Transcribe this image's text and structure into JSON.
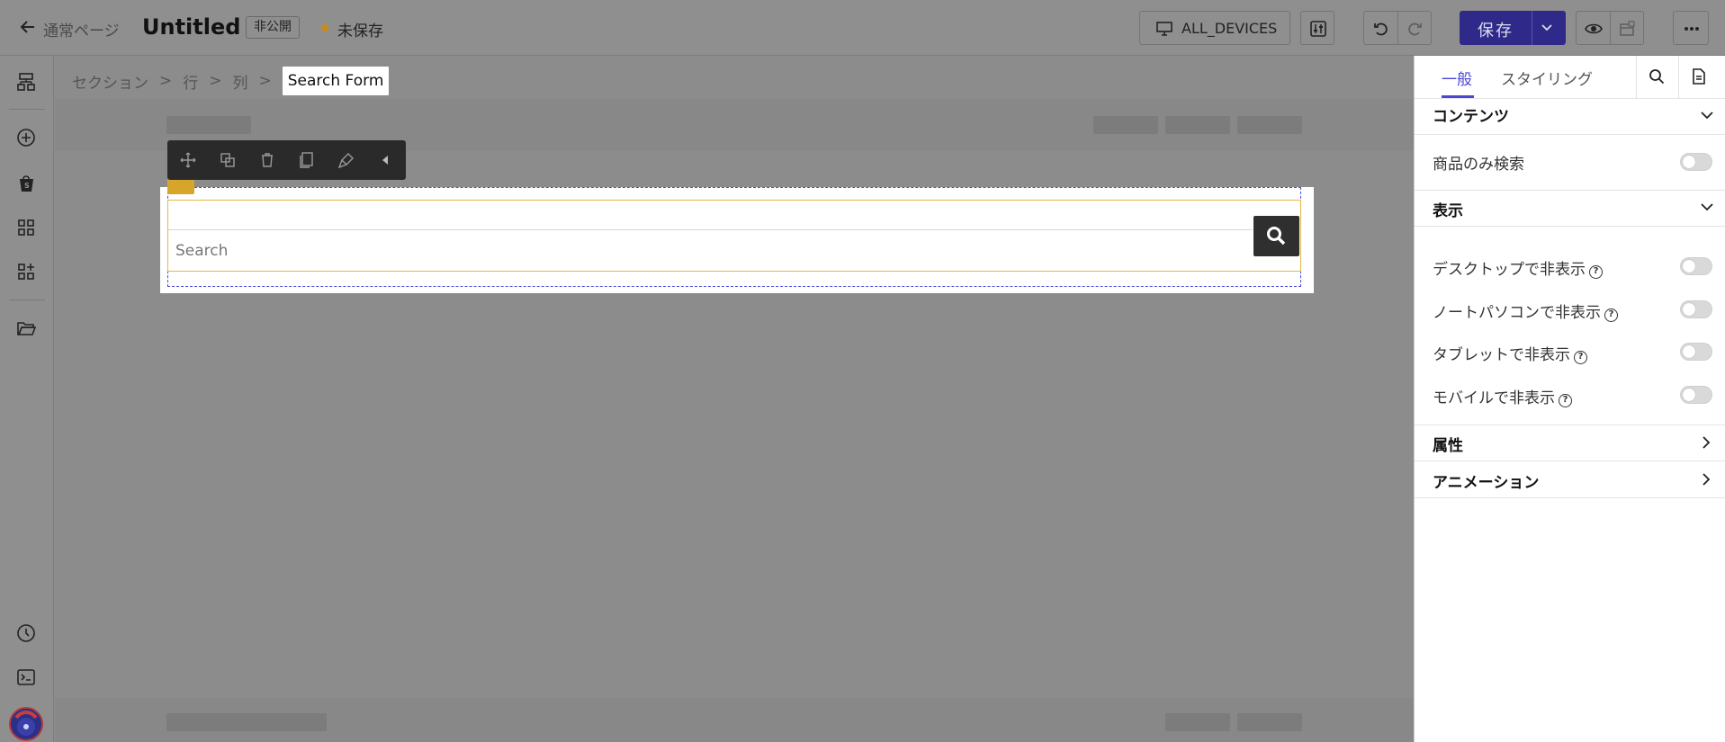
{
  "topbar": {
    "back_label": "通常ページ",
    "page_title": "Untitled",
    "privacy_badge": "非公開",
    "save_status": "未保存",
    "device_label": "ALL_DEVICES",
    "save_label": "保存"
  },
  "breadcrumb": {
    "items": [
      "セクション",
      "行",
      "列"
    ],
    "active": "Search Form"
  },
  "search_form": {
    "placeholder": "Search"
  },
  "panel": {
    "tabs": [
      "一般",
      "スタイリング"
    ],
    "active_tab": "一般",
    "sections": {
      "content": {
        "title": "コンテンツ",
        "products_only_label": "商品のみ検索"
      },
      "display": {
        "title": "表示",
        "hide_desktop": "デスクトップで非表示",
        "hide_laptop": "ノートパソコンで非表示",
        "hide_tablet": "タブレットで非表示",
        "hide_mobile": "モバイルで非表示"
      },
      "attributes": {
        "title": "属性"
      },
      "animation": {
        "title": "アニメーション"
      }
    }
  },
  "colors": {
    "accent": "#4a46d6",
    "save_button": "#2f2a8a",
    "selection": "#4d4ad8",
    "highlight": "#e4b64a"
  }
}
